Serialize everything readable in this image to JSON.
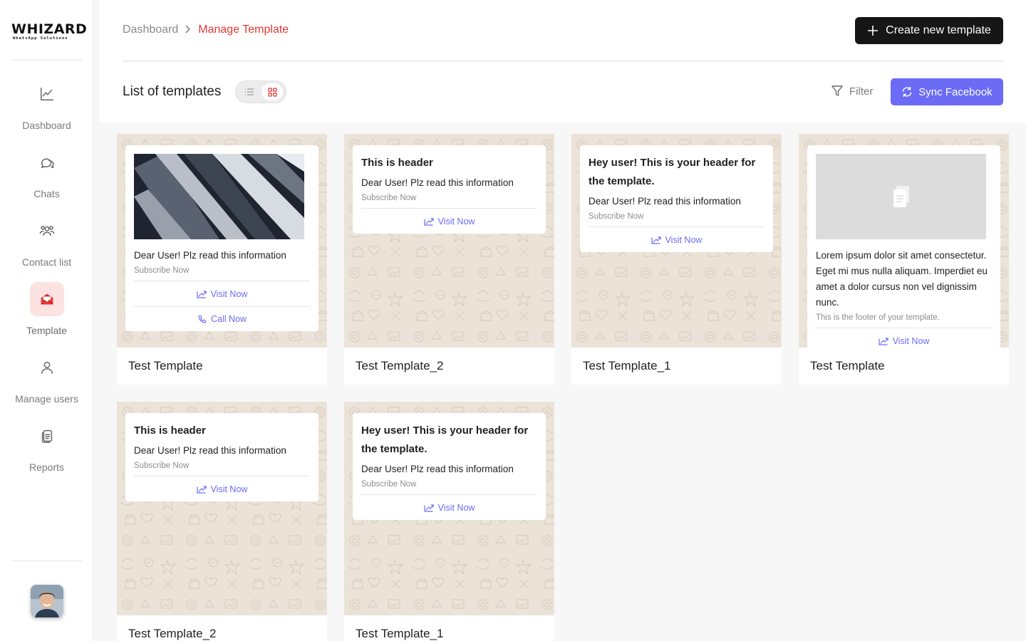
{
  "brand": {
    "name": "WHIZARD",
    "tagline": "WhatsApp Solutions"
  },
  "sidebar": {
    "items": [
      {
        "label": "Dashboard",
        "icon": "chart-line-icon",
        "active": false
      },
      {
        "label": "Chats",
        "icon": "chat-bubbles-icon",
        "active": false
      },
      {
        "label": "Contact list",
        "icon": "users-group-icon",
        "active": false
      },
      {
        "label": "Template",
        "icon": "envelope-open-icon",
        "active": true
      },
      {
        "label": "Manage users",
        "icon": "user-icon",
        "active": false
      },
      {
        "label": "Reports",
        "icon": "documents-icon",
        "active": false
      }
    ]
  },
  "breadcrumb": {
    "parent": "Dashboard",
    "current": "Manage Template"
  },
  "header": {
    "create_label": "Create new template",
    "list_title": "List of templates",
    "filter_label": "Filter",
    "sync_label": "Sync Facebook",
    "view_mode": "grid"
  },
  "colors": {
    "accent": "#6b6bf5",
    "danger": "#e53935",
    "dark": "#161616",
    "card_bg": "#ece3d8"
  },
  "templates": [
    {
      "name": "Test Template",
      "body": "Dear User! Plz read this information",
      "footer": "Subscribe Now",
      "actions": [
        "Visit Now",
        "Call Now"
      ],
      "media": "image"
    },
    {
      "name": "Test Template_2",
      "header": "This is header",
      "body": "Dear User! Plz read this information",
      "footer": "Subscribe Now",
      "actions": [
        "Visit Now"
      ]
    },
    {
      "name": "Test Template_1",
      "header": "Hey user! This is your header for the template.",
      "body": "Dear User! Plz read this information",
      "footer": "Subscribe Now",
      "actions": [
        "Visit Now"
      ]
    },
    {
      "name": "Test Template",
      "body": "Lorem ipsum dolor sit amet consectetur. Eget mi mus nulla aliquam. Imperdiet eu amet a dolor cursus non vel dignissim nunc.",
      "footer": "This is the footer of your template.",
      "actions": [
        "Visit Now"
      ],
      "media": "document"
    },
    {
      "name": "Test Template_2",
      "header": "This is header",
      "body": "Dear User! Plz read this information",
      "footer": "Subscribe Now",
      "actions": [
        "Visit Now"
      ]
    },
    {
      "name": "Test Template_1",
      "header": "Hey user! This is your header for the template.",
      "body": "Dear User! Plz read this information",
      "footer": "Subscribe Now",
      "actions": [
        "Visit Now"
      ]
    }
  ]
}
